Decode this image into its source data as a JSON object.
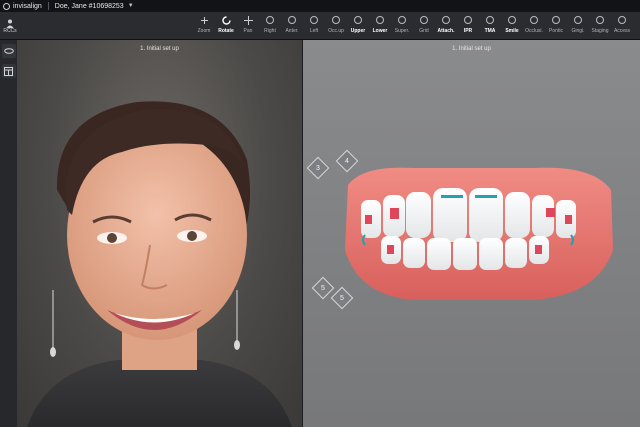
{
  "app": {
    "brand": "invisalign",
    "patient": "Doe, Jane #10698253"
  },
  "left_tool": {
    "label": "RCCs"
  },
  "toolbar": [
    {
      "id": "zoom",
      "label": "Zoom",
      "icon": "plus-minus-icon"
    },
    {
      "id": "rotate",
      "label": "Rotate",
      "icon": "rotate-icon",
      "active": true
    },
    {
      "id": "pan",
      "label": "Pan",
      "icon": "pan-icon"
    },
    {
      "id": "right",
      "label": "Right",
      "icon": "right-view-icon"
    },
    {
      "id": "anter",
      "label": "Anter.",
      "icon": "front-view-icon"
    },
    {
      "id": "left",
      "label": "Left",
      "icon": "left-view-icon"
    },
    {
      "id": "occlusal",
      "label": "Occ.up",
      "icon": "occlusal-icon"
    },
    {
      "id": "upper",
      "label": "Upper",
      "icon": "upper-arch-icon",
      "active": true
    },
    {
      "id": "lower",
      "label": "Lower",
      "icon": "lower-arch-icon",
      "active": true
    },
    {
      "id": "super",
      "label": "Super.",
      "icon": "superimpose-icon"
    },
    {
      "id": "grid",
      "label": "Grid",
      "icon": "grid-icon"
    },
    {
      "id": "attach",
      "label": "Attach.",
      "icon": "attachment-icon",
      "active": true
    },
    {
      "id": "ipr",
      "label": "IPR",
      "icon": "ipr-icon",
      "active": true
    },
    {
      "id": "tma",
      "label": "TMA",
      "icon": "tma-icon",
      "active": true
    },
    {
      "id": "smile",
      "label": "Smile",
      "icon": "smile-icon",
      "active": true
    },
    {
      "id": "occlusio",
      "label": "Occlusi.",
      "icon": "occlusion-icon"
    },
    {
      "id": "pontic",
      "label": "Pontic",
      "icon": "pontic-icon"
    },
    {
      "id": "gingi",
      "label": "Gingi.",
      "icon": "gingiva-icon"
    },
    {
      "id": "staging",
      "label": "Staging",
      "icon": "staging-icon"
    },
    {
      "id": "more",
      "label": "Access",
      "icon": "folder-icon"
    }
  ],
  "photo_panel": {
    "title": "1. Initial set up"
  },
  "model_panel": {
    "title": "1. Initial set up"
  },
  "stage_markers": [
    {
      "label": "3"
    },
    {
      "label": "4"
    },
    {
      "label": "5"
    },
    {
      "label": "5"
    }
  ],
  "colors": {
    "accent_attachment": "#e0465a",
    "accent_tma": "#1fa3b5"
  }
}
